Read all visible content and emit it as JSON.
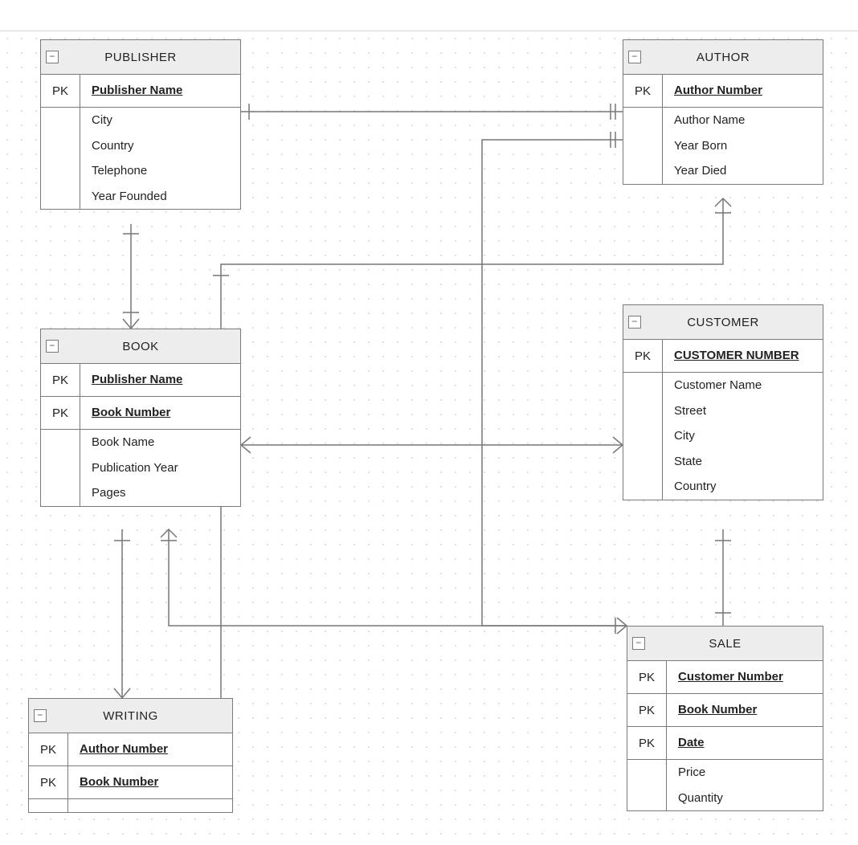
{
  "entities": {
    "publisher": {
      "title": "PUBLISHER",
      "pk": [
        {
          "k": "PK",
          "label": "Publisher Name"
        }
      ],
      "attrs": [
        "City",
        "Country",
        "Telephone",
        "Year Founded"
      ]
    },
    "author": {
      "title": "AUTHOR",
      "pk": [
        {
          "k": "PK",
          "label": "Author Number"
        }
      ],
      "attrs": [
        "Author Name",
        "Year Born",
        "Year Died"
      ]
    },
    "book": {
      "title": "BOOK",
      "pk": [
        {
          "k": "PK",
          "label": "Publisher Name"
        },
        {
          "k": "PK",
          "label": "Book Number"
        }
      ],
      "attrs": [
        "Book Name",
        "Publication Year",
        "Pages"
      ]
    },
    "customer": {
      "title": "CUSTOMER",
      "pk": [
        {
          "k": "PK",
          "label": "CUSTOMER NUMBER"
        }
      ],
      "attrs": [
        "Customer Name",
        "Street",
        "City",
        "State",
        "Country"
      ]
    },
    "writing": {
      "title": "WRITING",
      "pk": [
        {
          "k": "PK",
          "label": "Author Number"
        },
        {
          "k": "PK",
          "label": "Book Number"
        }
      ],
      "attrs": []
    },
    "sale": {
      "title": "SALE",
      "pk": [
        {
          "k": "PK",
          "label": "Customer Number"
        },
        {
          "k": "PK",
          "label": "Book Number"
        },
        {
          "k": "PK",
          "label": "Date"
        }
      ],
      "attrs": [
        "Price",
        "Quantity"
      ]
    }
  },
  "toggle": "−"
}
